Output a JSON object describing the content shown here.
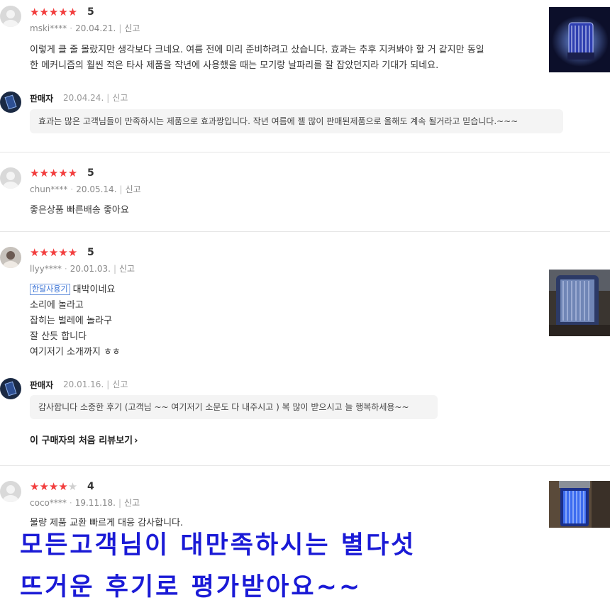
{
  "reviews": [
    {
      "stars": "★★★★★",
      "stars_off": "",
      "score": "5",
      "user": "mski****",
      "date": "20.04.21.",
      "report": "신고",
      "lines": [
        "이렇게 클 줄 몰랐지만 생각보다 크네요. 여름 전에 미리 준비하려고 샀습니다. 효과는 추후 지켜봐야 할 거 같지만 동일",
        "한 메커니즘의 훨씬 적은 타사 제품을 작년에 사용했을 때는 모기랑 날파리를 잘 잡았던지라 기대가 되네요."
      ],
      "seller": {
        "name": "판매자",
        "date": "20.04.24.",
        "report": "신고",
        "reply": "효과는 많은 고객님들이 만족하시는 제품으로 효과짱입니다. 작년 여름에 젤 많이 판매된제품으로 올해도 계속 될거라고 믿습니다.~~~"
      }
    },
    {
      "stars": "★★★★★",
      "stars_off": "",
      "score": "5",
      "user": "chun****",
      "date": "20.05.14.",
      "report": "신고",
      "lines": [
        "좋은상품 빠른배송 좋아요"
      ]
    },
    {
      "stars": "★★★★★",
      "stars_off": "",
      "score": "5",
      "user": "llyy****",
      "date": "20.01.03.",
      "report": "신고",
      "tag": "한달사용기",
      "lines": [
        "대박이네요",
        "소리에 놀라고",
        "잡히는 벌레에 놀라구",
        "잘 산듯 합니다",
        "여기저기 소개까지 ㅎㅎ"
      ],
      "seller": {
        "name": "판매자",
        "date": "20.01.16.",
        "report": "신고",
        "reply": "감사합니다 소중한 후기 (고객님 ~~ 여기저기 소문도 다 내주시고 ) 복 많이 받으시고 늘 행복하세용~~"
      },
      "first_review_link": "이 구매자의 처음 리뷰보기"
    },
    {
      "stars": "★★★★",
      "stars_off": "★",
      "score": "4",
      "user": "coco****",
      "date": "19.11.18.",
      "report": "신고",
      "lines": [
        "물량 제품 교환 빠르게 대응 감사합니다."
      ]
    }
  ],
  "banner": {
    "line1": "모든고객님이 대만족하시는 별다섯",
    "line2": "뜨거운 후기로 평가받아요~~"
  },
  "colors": {
    "star": "#f23d3d",
    "banner": "#1a1ad6",
    "tag": "#3a73d6"
  },
  "icons": {
    "chevron": "›"
  }
}
